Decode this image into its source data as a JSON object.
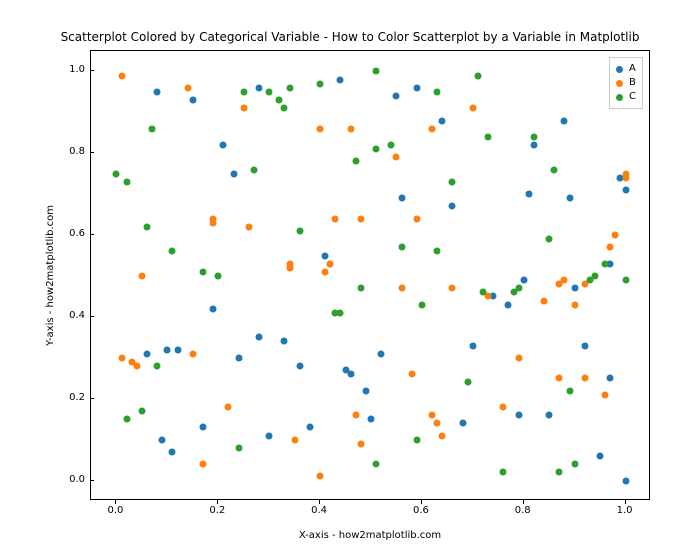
{
  "chart_data": {
    "type": "scatter",
    "title": "Scatterplot Colored by Categorical Variable - How to Color Scatterplot by a Variable in Matplotlib",
    "xlabel": "X-axis - how2matplotlib.com",
    "ylabel": "Y-axis - how2matplotlib.com",
    "xlim": [
      -0.05,
      1.05
    ],
    "ylim": [
      -0.05,
      1.05
    ],
    "xticks": [
      0.0,
      0.2,
      0.4,
      0.6,
      0.8,
      1.0
    ],
    "yticks": [
      0.0,
      0.2,
      0.4,
      0.6,
      0.8,
      1.0
    ],
    "legend_position": "upper_right",
    "series": [
      {
        "name": "A",
        "color": "#1f77b4",
        "points": [
          [
            0.08,
            0.95
          ],
          [
            0.1,
            0.32
          ],
          [
            0.09,
            0.1
          ],
          [
            0.11,
            0.07
          ],
          [
            0.15,
            0.93
          ],
          [
            0.17,
            0.13
          ],
          [
            0.19,
            0.42
          ],
          [
            0.21,
            0.82
          ],
          [
            0.24,
            0.3
          ],
          [
            0.23,
            0.75
          ],
          [
            0.28,
            0.35
          ],
          [
            0.3,
            0.11
          ],
          [
            0.33,
            0.34
          ],
          [
            0.36,
            0.28
          ],
          [
            0.38,
            0.13
          ],
          [
            0.41,
            0.55
          ],
          [
            0.42,
            0.53
          ],
          [
            0.45,
            0.27
          ],
          [
            0.46,
            0.26
          ],
          [
            0.49,
            0.22
          ],
          [
            0.5,
            0.15
          ],
          [
            0.52,
            0.31
          ],
          [
            0.56,
            0.69
          ],
          [
            0.55,
            0.94
          ],
          [
            0.59,
            0.96
          ],
          [
            0.66,
            0.67
          ],
          [
            0.68,
            0.14
          ],
          [
            0.7,
            0.33
          ],
          [
            0.74,
            0.45
          ],
          [
            0.77,
            0.43
          ],
          [
            0.79,
            0.16
          ],
          [
            0.8,
            0.49
          ],
          [
            0.81,
            0.7
          ],
          [
            0.82,
            0.82
          ],
          [
            0.85,
            0.16
          ],
          [
            0.88,
            0.88
          ],
          [
            0.89,
            0.69
          ],
          [
            0.9,
            0.47
          ],
          [
            0.92,
            0.33
          ],
          [
            0.95,
            0.06
          ],
          [
            0.97,
            0.25
          ],
          [
            0.97,
            0.53
          ],
          [
            0.99,
            0.74
          ],
          [
            1.0,
            0.71
          ],
          [
            1.0,
            0.0
          ],
          [
            0.06,
            0.31
          ],
          [
            0.12,
            0.32
          ],
          [
            0.28,
            0.96
          ],
          [
            0.44,
            0.98
          ],
          [
            0.64,
            0.88
          ]
        ]
      },
      {
        "name": "B",
        "color": "#ff7f0e",
        "points": [
          [
            0.01,
            0.99
          ],
          [
            0.03,
            0.29
          ],
          [
            0.05,
            0.5
          ],
          [
            0.04,
            0.28
          ],
          [
            0.14,
            0.96
          ],
          [
            0.15,
            0.31
          ],
          [
            0.17,
            0.04
          ],
          [
            0.19,
            0.64
          ],
          [
            0.19,
            0.63
          ],
          [
            0.22,
            0.18
          ],
          [
            0.25,
            0.91
          ],
          [
            0.26,
            0.62
          ],
          [
            0.34,
            0.52
          ],
          [
            0.35,
            0.1
          ],
          [
            0.4,
            0.86
          ],
          [
            0.41,
            0.51
          ],
          [
            0.4,
            0.01
          ],
          [
            0.43,
            0.64
          ],
          [
            0.46,
            0.86
          ],
          [
            0.48,
            0.64
          ],
          [
            0.55,
            0.79
          ],
          [
            0.56,
            0.47
          ],
          [
            0.58,
            0.26
          ],
          [
            0.62,
            0.86
          ],
          [
            0.62,
            0.16
          ],
          [
            0.64,
            0.11
          ],
          [
            0.66,
            0.47
          ],
          [
            0.7,
            0.91
          ],
          [
            0.73,
            0.45
          ],
          [
            0.76,
            0.18
          ],
          [
            0.79,
            0.3
          ],
          [
            0.84,
            0.44
          ],
          [
            0.87,
            0.25
          ],
          [
            0.88,
            0.49
          ],
          [
            0.9,
            0.43
          ],
          [
            0.92,
            0.48
          ],
          [
            0.96,
            0.21
          ],
          [
            0.97,
            0.57
          ],
          [
            0.98,
            0.6
          ],
          [
            1.0,
            0.75
          ],
          [
            1.0,
            0.74
          ],
          [
            0.01,
            0.3
          ],
          [
            0.92,
            0.25
          ],
          [
            0.34,
            0.53
          ],
          [
            0.48,
            0.09
          ],
          [
            0.59,
            0.64
          ],
          [
            0.63,
            0.14
          ],
          [
            0.47,
            0.16
          ],
          [
            0.87,
            0.48
          ],
          [
            0.42,
            0.53
          ]
        ]
      },
      {
        "name": "C",
        "color": "#2ca02c",
        "points": [
          [
            0.0,
            0.75
          ],
          [
            0.02,
            0.73
          ],
          [
            0.02,
            0.15
          ],
          [
            0.05,
            0.17
          ],
          [
            0.06,
            0.62
          ],
          [
            0.07,
            0.86
          ],
          [
            0.08,
            0.28
          ],
          [
            0.11,
            0.56
          ],
          [
            0.17,
            0.51
          ],
          [
            0.2,
            0.5
          ],
          [
            0.24,
            0.08
          ],
          [
            0.27,
            0.76
          ],
          [
            0.3,
            0.95
          ],
          [
            0.32,
            0.93
          ],
          [
            0.34,
            0.96
          ],
          [
            0.33,
            0.91
          ],
          [
            0.4,
            0.97
          ],
          [
            0.43,
            0.41
          ],
          [
            0.44,
            0.41
          ],
          [
            0.47,
            0.78
          ],
          [
            0.48,
            0.47
          ],
          [
            0.51,
            1.0
          ],
          [
            0.51,
            0.81
          ],
          [
            0.54,
            0.82
          ],
          [
            0.56,
            0.57
          ],
          [
            0.59,
            0.1
          ],
          [
            0.6,
            0.43
          ],
          [
            0.63,
            0.95
          ],
          [
            0.66,
            0.73
          ],
          [
            0.69,
            0.24
          ],
          [
            0.71,
            0.99
          ],
          [
            0.72,
            0.46
          ],
          [
            0.73,
            0.84
          ],
          [
            0.76,
            0.02
          ],
          [
            0.78,
            0.46
          ],
          [
            0.79,
            0.47
          ],
          [
            0.82,
            0.84
          ],
          [
            0.85,
            0.59
          ],
          [
            0.86,
            0.76
          ],
          [
            0.87,
            0.02
          ],
          [
            0.89,
            0.22
          ],
          [
            0.9,
            0.04
          ],
          [
            0.93,
            0.49
          ],
          [
            0.94,
            0.5
          ],
          [
            0.96,
            0.53
          ],
          [
            1.0,
            0.49
          ],
          [
            0.51,
            0.04
          ],
          [
            0.63,
            0.56
          ],
          [
            0.36,
            0.61
          ],
          [
            0.25,
            0.95
          ]
        ]
      }
    ]
  }
}
